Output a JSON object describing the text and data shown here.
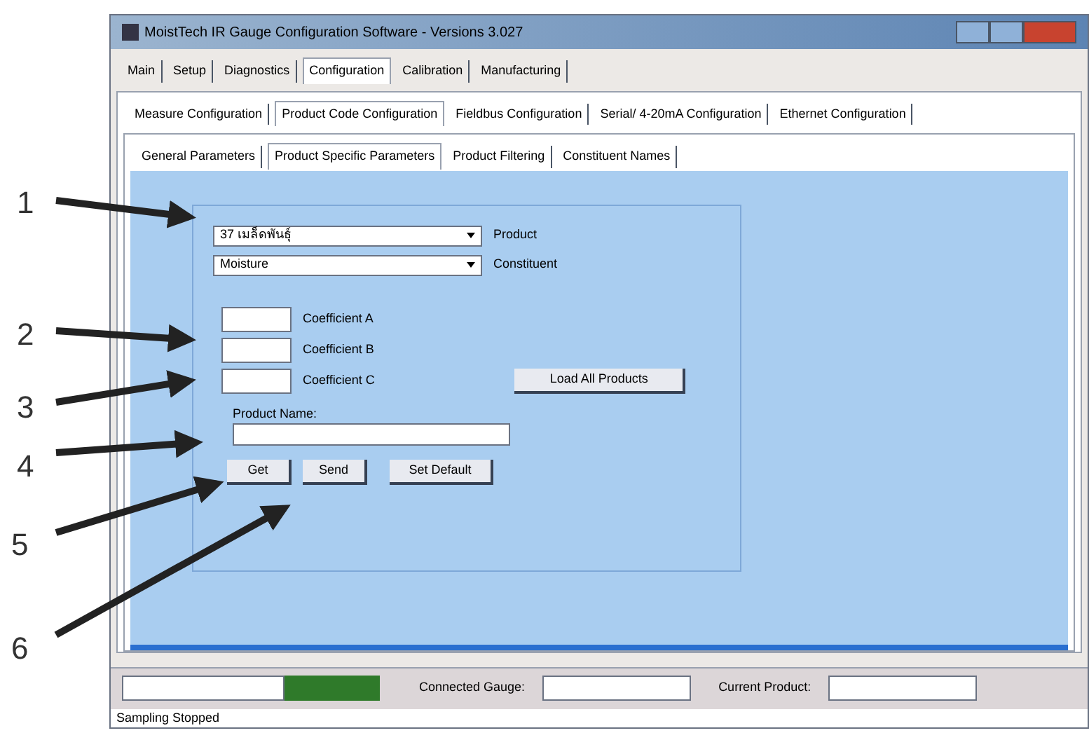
{
  "window": {
    "title": "MoistTech IR Gauge Configuration Software - Versions  3.027"
  },
  "main_tabs": [
    {
      "label": "Main",
      "selected": false
    },
    {
      "label": "Setup",
      "selected": false
    },
    {
      "label": "Diagnostics",
      "selected": false
    },
    {
      "label": "Configuration",
      "selected": true
    },
    {
      "label": "Calibration",
      "selected": false
    },
    {
      "label": "Manufacturing",
      "selected": false
    }
  ],
  "config_tabs": [
    {
      "label": "Measure Configuration",
      "selected": false
    },
    {
      "label": "Product Code Configuration",
      "selected": true
    },
    {
      "label": "Fieldbus Configuration",
      "selected": false
    },
    {
      "label": "Serial/ 4-20mA Configuration",
      "selected": false
    },
    {
      "label": "Ethernet Configuration",
      "selected": false
    }
  ],
  "product_tabs": [
    {
      "label": "General Parameters",
      "selected": false
    },
    {
      "label": "Product Specific Parameters",
      "selected": true
    },
    {
      "label": "Product Filtering",
      "selected": false
    },
    {
      "label": "Constituent Names",
      "selected": false
    }
  ],
  "dropdowns": [
    {
      "value": "37  เมล็ดพันธุ์",
      "label": "Product"
    },
    {
      "value": "Moisture",
      "label": "Constituent"
    }
  ],
  "coefficients": [
    {
      "label": "Coefficient A"
    },
    {
      "label": "Coefficient B"
    },
    {
      "label": "Coefficient C"
    }
  ],
  "load_button": "Load All Products",
  "product_name": {
    "label": "Product Name:"
  },
  "buttons": [
    "Get",
    "Send",
    "Set Default"
  ],
  "status": {
    "connected_label": "Connected Gauge:",
    "current_label": "Current Product:",
    "message": "Sampling Stopped"
  },
  "annotations": [
    {
      "label": "1"
    },
    {
      "label": "2"
    },
    {
      "label": "3"
    },
    {
      "label": "4"
    },
    {
      "label": "5"
    },
    {
      "label": "6"
    }
  ]
}
